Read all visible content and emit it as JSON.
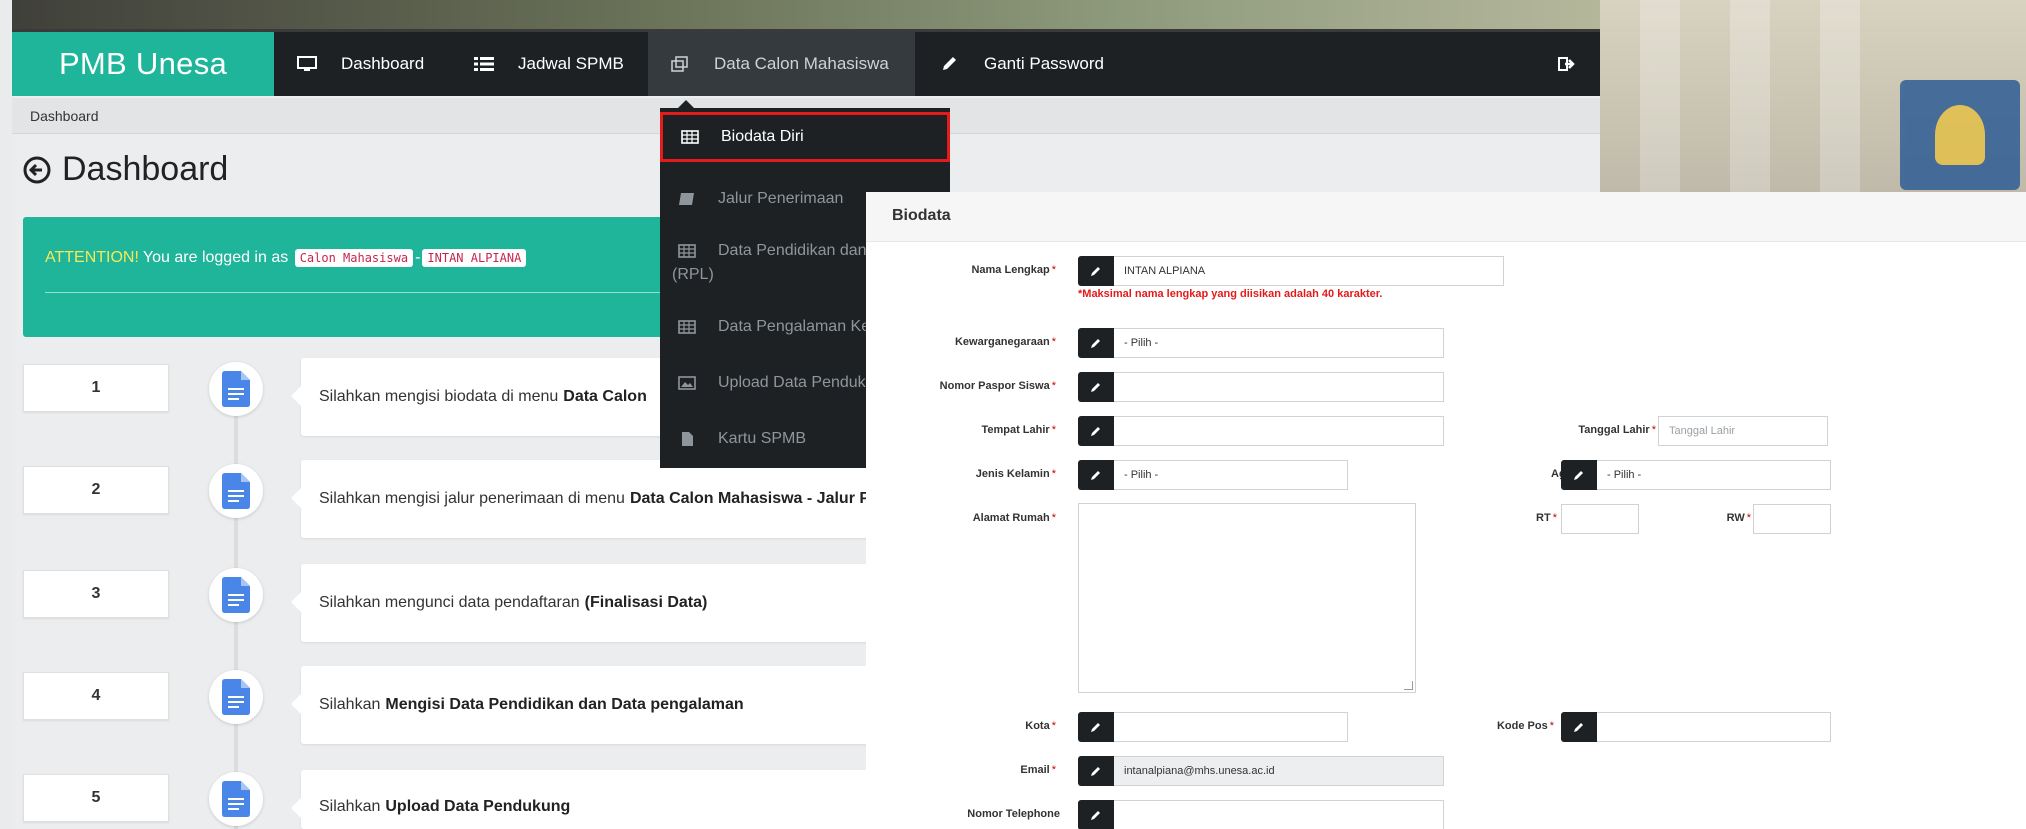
{
  "navbar": {
    "brand": "PMB Unesa",
    "items": [
      {
        "label": "Dashboard"
      },
      {
        "label": "Jadwal SPMB"
      },
      {
        "label": "Data Calon Mahasiswa"
      },
      {
        "label": "Ganti Password"
      }
    ]
  },
  "breadcrumb": "Dashboard",
  "page_title": "Dashboard",
  "attention": {
    "prefix": "ATTENTION!",
    "text": "You are logged in as",
    "role": "Calon Mahasiswa",
    "separator": "-",
    "user": "INTAN ALPIANA"
  },
  "steps": [
    {
      "number": "1",
      "text": "Silahkan mengisi biodata di menu",
      "bold": "Data Calon"
    },
    {
      "number": "2",
      "text": "Silahkan mengisi jalur penerimaan di menu",
      "bold": "Data Calon Mahasiswa - Jalur P"
    },
    {
      "number": "3",
      "text": "Silahkan mengunci data pendaftaran",
      "bold": "(Finalisasi Data)"
    },
    {
      "number": "4",
      "text": "Silahkan",
      "bold": "Mengisi Data Pendidikan dan Data pengalaman"
    },
    {
      "number": "5",
      "text": "Silahkan",
      "bold": "Upload Data Pendukung"
    }
  ],
  "dropdown": {
    "items": [
      {
        "label": "Biodata Diri"
      },
      {
        "label": "Jalur Penerimaan"
      },
      {
        "label": "Data Pendidikan dan P"
      },
      {
        "label": "(RPL)"
      },
      {
        "label": "Data Pengalaman Kerj"
      },
      {
        "label": "Upload Data Pendukun"
      },
      {
        "label": "Kartu SPMB"
      }
    ]
  },
  "biodata": {
    "title": "Biodata",
    "required_mark": "*",
    "fields": {
      "nama_lengkap": {
        "label": "Nama Lengkap",
        "value": "INTAN ALPIANA"
      },
      "warning": "*Maksimal nama lengkap yang diisikan adalah 40 karakter.",
      "kewarganegaraan": {
        "label": "Kewarganegaraan",
        "value": "- Pilih -"
      },
      "nomor_paspor": {
        "label": "Nomor Paspor Siswa",
        "value": ""
      },
      "tempat_lahir": {
        "label": "Tempat Lahir",
        "value": ""
      },
      "tanggal_lahir": {
        "label": "Tanggal Lahir",
        "placeholder": "Tanggal Lahir"
      },
      "jenis_kelamin": {
        "label": "Jenis Kelamin",
        "value": "- Pilih -"
      },
      "agama": {
        "label": "Agama",
        "value": "- Pilih -"
      },
      "alamat_rumah": {
        "label": "Alamat Rumah",
        "value": ""
      },
      "rt": {
        "label": "RT",
        "value": ""
      },
      "rw": {
        "label": "RW",
        "value": ""
      },
      "kota": {
        "label": "Kota",
        "value": ""
      },
      "kode_pos": {
        "label": "Kode Pos",
        "value": ""
      },
      "email": {
        "label": "Email",
        "value": "intanalpiana@mhs.unesa.ac.id"
      },
      "nomor_telephone": {
        "label": "Nomor Telephone",
        "value": ""
      }
    }
  },
  "colors": {
    "brand": "#1fb59a",
    "navbar": "#1e2124",
    "highlight": "#e31b1b",
    "step_icon": "#4a86e8",
    "attention_warn": "#f6e85a"
  }
}
